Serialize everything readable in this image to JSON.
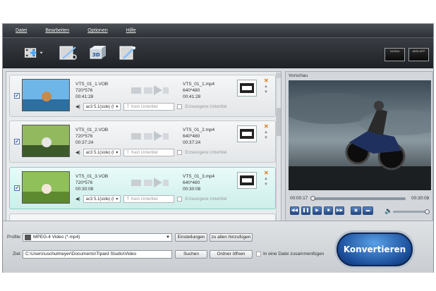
{
  "colors": {
    "accent": "#1c4f9c",
    "toolbar": "#2a2e33",
    "selected_row": "#cdeeea",
    "remove_icon": "#e07010"
  },
  "menu": [
    "Datei",
    "Bearbeiten",
    "Optionen",
    "Hilfe"
  ],
  "toolbar": {
    "icons": [
      "add-file-icon",
      "edit-video-icon",
      "3d-icon",
      "effects-icon"
    ],
    "badges": [
      "NVIDIA",
      "AMD APP"
    ]
  },
  "items": [
    {
      "source_name": "VTS_01_1.VOB",
      "source_res": "720*576",
      "source_dur": "00:41:28",
      "target_name": "VTS_01_1.mp4",
      "target_res": "640*480",
      "target_dur": "00:41:28",
      "audio": "ac3 5.1(side) (l",
      "subtitle": "Kein Untertitel",
      "forced": "Erzwungene Untertitel",
      "checked": true,
      "selected": false
    },
    {
      "source_name": "VTS_01_2.VOB",
      "source_res": "720*576",
      "source_dur": "00:37:24",
      "target_name": "VTS_01_2.mp4",
      "target_res": "640*480",
      "target_dur": "00:37:24",
      "audio": "ac3 5.1(side) (l",
      "subtitle": "Kein Untertitel",
      "forced": "Erzwungene Untertitel",
      "checked": true,
      "selected": false
    },
    {
      "source_name": "VTS_01_3.VOB",
      "source_res": "720*576",
      "source_dur": "00:30:08",
      "target_name": "VTS_01_3.mp4",
      "target_res": "640*480",
      "target_dur": "00:30:08",
      "audio": "ac3 5.1(side) (l",
      "subtitle": "Kein Untertitel",
      "forced": "Erzwungene Untertitel",
      "checked": true,
      "selected": true
    }
  ],
  "preview": {
    "title": "Vorschau",
    "time_current": "00:00:17",
    "time_total": "00:30:08",
    "progress": 0.01
  },
  "bottom": {
    "profile_label": "Profile:",
    "profile_value": "MPEG-4 Video (*.mp4)",
    "settings_button": "Einstellungen",
    "apply_all_button": "zu allen hinzufügen",
    "target_label": "Ziel:",
    "target_path": "C:\\Users\\uschulmeyer\\Documents\\Tipard Studio\\Video",
    "browse_button": "Suchen",
    "open_folder_button": "Ordner öffnen",
    "merge_label": "In eine Datei zusammenfügen",
    "convert_button": "Konvertieren"
  }
}
